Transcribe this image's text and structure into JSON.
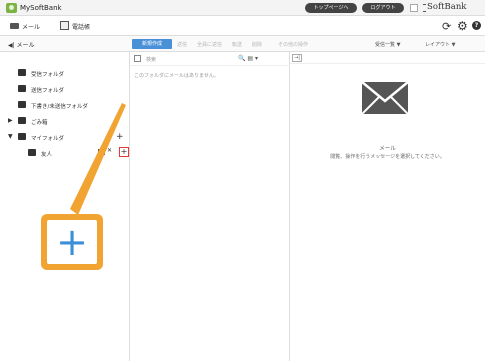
{
  "header": {
    "app_title": "MySoftBank",
    "pill_1": "トップページへ",
    "pill_2": "ログアウト",
    "brand": "SoftBank"
  },
  "nav": {
    "mail_label": "メール",
    "address_book_label": "電話帳"
  },
  "toolbar": {
    "mail_toggle": "◀| メール",
    "compose_label": "新規作成",
    "items": [
      "返信",
      "全員に返信",
      "転送",
      "削除",
      "その他の操作"
    ],
    "right_1": "受信一覧 ▼",
    "right_2": "レイアウト ▼"
  },
  "folders": [
    {
      "label": "受信フォルダ"
    },
    {
      "label": "送信フォルダ"
    },
    {
      "label": "下書き/未送信フォルダ"
    },
    {
      "label": "ごみ箱",
      "caret": "▶"
    },
    {
      "label": "マイフォルダ",
      "caret": "▼"
    }
  ],
  "subfolder": {
    "label": "友人"
  },
  "mid": {
    "search_placeholder": "検索",
    "empty_message": "このフォルダにメールはありません。"
  },
  "reader": {
    "title": "メール",
    "message": "閲覧、操作を行うメッセージを選択してください。"
  },
  "colors": {
    "accent": "#4a90d9",
    "callout": "#f2a432",
    "highlight": "#e53935"
  }
}
